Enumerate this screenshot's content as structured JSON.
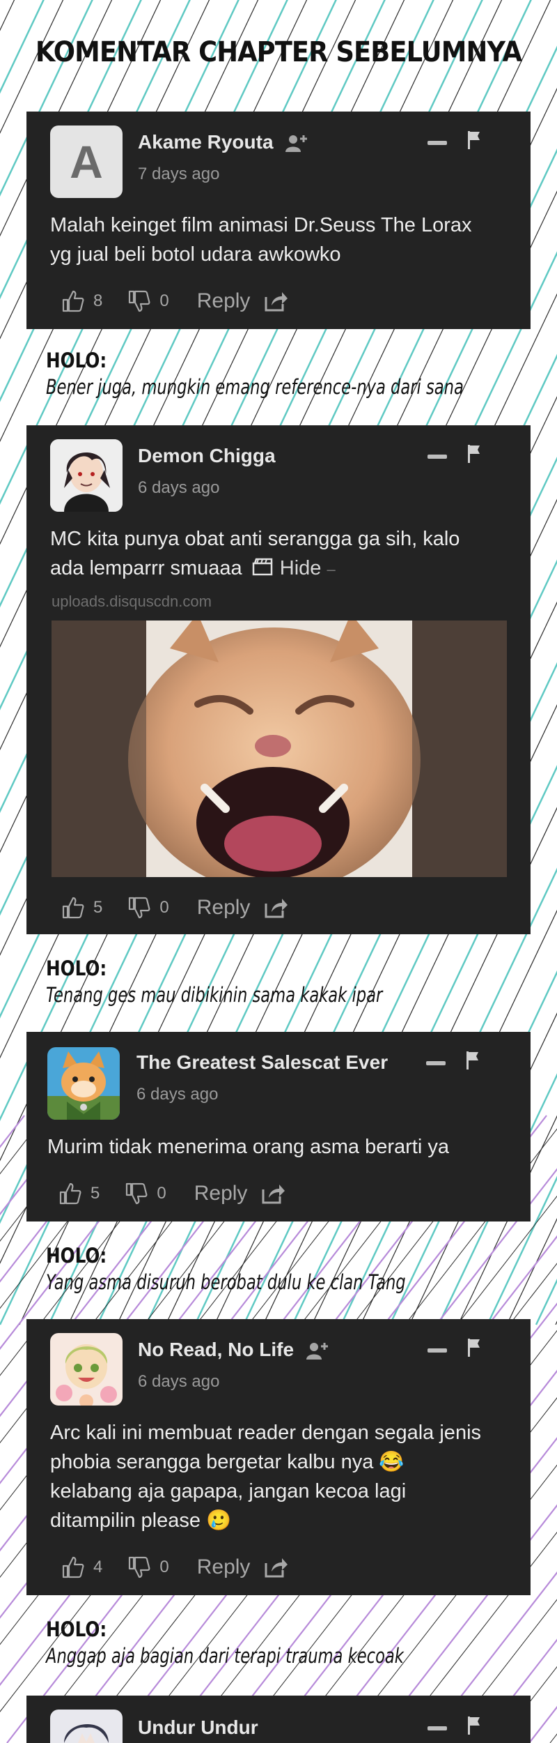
{
  "page": {
    "title": "KOMENTAR CHAPTER SEBELUMNYA",
    "colors": {
      "background": "#ffffff",
      "card": "#232323",
      "stripe_teal": "#5fc9c3",
      "stripe_purple": "#b78ad9"
    }
  },
  "comments": [
    {
      "author": "Akame Ryouta",
      "avatar_letter": "A",
      "time": "7 days ago",
      "text": [
        "Malah keinget film animasi Dr.Seuss The Lorax",
        "yg jual beli botol udara awkowko"
      ],
      "upvotes": "8",
      "downvotes": "0",
      "reply_label": "Reply",
      "icons": [
        "add-user-icon",
        "minus-icon",
        "flag-icon",
        "thumbs-up-icon",
        "thumbs-down-icon",
        "share-icon"
      ]
    },
    {
      "author": "Demon Chigga",
      "time": "6 days ago",
      "text": [
        "MC kita punya obat anti serangga ga sih, kalo",
        "ada lemparrr smuaaa"
      ],
      "hide_label": "Hide",
      "hide_dash": "–",
      "upload_source": "uploads.disquscdn.com",
      "upvotes": "5",
      "downvotes": "0",
      "reply_label": "Reply",
      "icons": [
        "minus-icon",
        "flag-icon",
        "image-icon",
        "thumbs-up-icon",
        "thumbs-down-icon",
        "share-icon"
      ]
    },
    {
      "author": "The Greatest Salescat Ever",
      "time": "6 days ago",
      "text": [
        "Murim tidak menerima orang asma berarti ya"
      ],
      "upvotes": "5",
      "downvotes": "0",
      "reply_label": "Reply",
      "icons": [
        "minus-icon",
        "flag-icon",
        "thumbs-up-icon",
        "thumbs-down-icon",
        "share-icon"
      ]
    },
    {
      "author": "No Read, No Life",
      "time": "6 days ago",
      "text": [
        "Arc kali ini membuat reader dengan segala jenis",
        "phobia serangga bergetar kalbu nya 😂",
        "kelabang aja gapapa, jangan kecoa lagi",
        "ditampilin please 🥲"
      ],
      "upvotes": "4",
      "downvotes": "0",
      "reply_label": "Reply",
      "icons": [
        "add-user-icon",
        "minus-icon",
        "flag-icon",
        "thumbs-up-icon",
        "thumbs-down-icon",
        "share-icon"
      ]
    },
    {
      "author": "Undur Undur",
      "icons": [
        "minus-icon",
        "flag-icon"
      ]
    }
  ],
  "replies": [
    {
      "label": "HOLO:",
      "text": "Bener juga, mungkin emang reference-nya dari sana"
    },
    {
      "label": "HOLO:",
      "text": "Tenang ges mau dibikinin sama kakak ipar"
    },
    {
      "label": "HOLO:",
      "text": "Yang asma disuruh berobat dulu ke clan Tang"
    },
    {
      "label": "HOLO:",
      "text": "Anggap aja bagian dari terapi trauma kecoak"
    }
  ]
}
